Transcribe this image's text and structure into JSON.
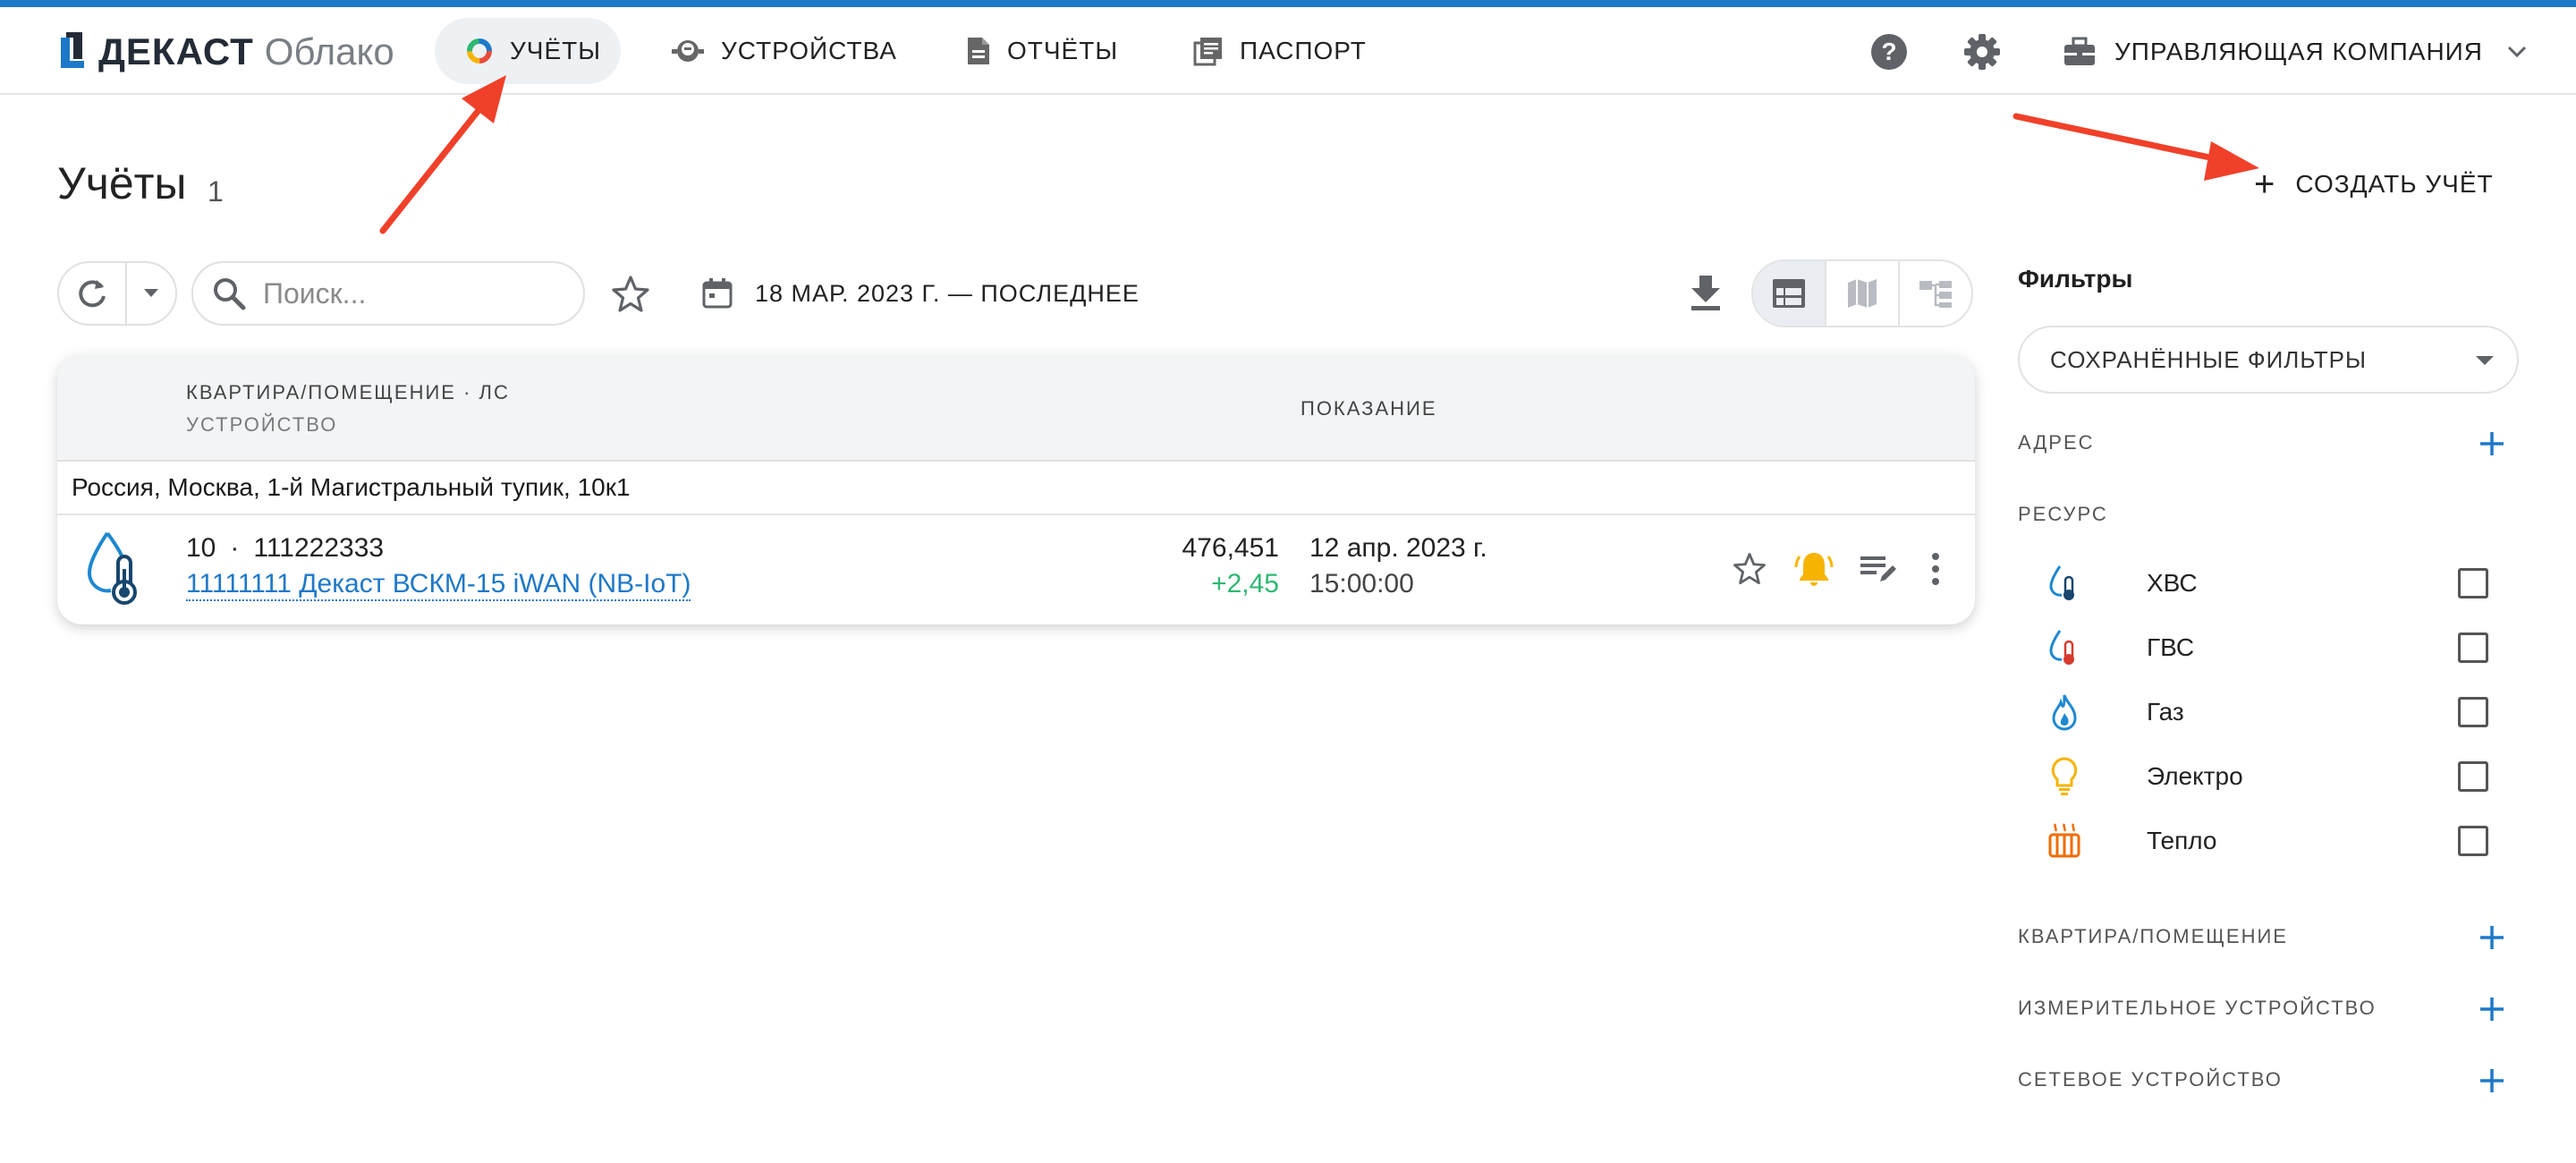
{
  "brand": {
    "name": "ДЕКАСТ",
    "product": "Облако"
  },
  "nav": [
    {
      "label": "УЧЁТЫ",
      "icon": "donut-chart-icon",
      "active": true
    },
    {
      "label": "УСТРОЙСТВА",
      "icon": "meter-device-icon",
      "active": false
    },
    {
      "label": "ОТЧЁТЫ",
      "icon": "document-icon",
      "active": false
    },
    {
      "label": "ПАСПОРТ",
      "icon": "passport-book-icon",
      "active": false
    }
  ],
  "header": {
    "help_icon": "help-circle-icon",
    "settings_icon": "gear-icon",
    "company": "УПРАВЛЯЮЩАЯ КОМПАНИЯ"
  },
  "page": {
    "title": "Учёты",
    "count": "1",
    "create_label": "СОЗДАТЬ УЧЁТ"
  },
  "toolbar": {
    "search_placeholder": "Поиск...",
    "date_range": "18 МАР. 2023 Г. — ПОСЛЕДНЕЕ",
    "views": [
      "table-view-icon",
      "map-view-icon",
      "tree-view-icon"
    ],
    "active_view": "table-view-icon"
  },
  "table": {
    "col_apartment": "КВАРТИРА/ПОМЕЩЕНИЕ · ЛС",
    "col_device": "УСТРОЙСТВО",
    "col_reading": "ПОКАЗАНИЕ",
    "group": "Россия, Москва, 1-й Магистральный тупик, 10к1",
    "rows": [
      {
        "apartment": "10",
        "account": "111222333",
        "device": "11111111 Декаст ВСКМ-15 iWAN (NB-IoT)",
        "value": "476,451",
        "delta": "+2,45",
        "date": "12 апр. 2023 г.",
        "time": "15:00:00",
        "resource_icon": "cold-water-icon"
      }
    ]
  },
  "filters": {
    "title": "Фильтры",
    "saved": "СОХРАНЁННЫЕ ФИЛЬТРЫ",
    "address": "АДРЕС",
    "resource": "РЕСУРС",
    "resources": [
      {
        "label": "ХВС",
        "icon": "cold-water-icon",
        "checked": false
      },
      {
        "label": "ГВС",
        "icon": "hot-water-icon",
        "checked": false
      },
      {
        "label": "Газ",
        "icon": "gas-flame-icon",
        "checked": false
      },
      {
        "label": "Электро",
        "icon": "lightbulb-icon",
        "checked": false
      },
      {
        "label": "Тепло",
        "icon": "radiator-icon",
        "checked": false
      }
    ],
    "apartment": "КВАРТИРА/ПОМЕЩЕНИЕ",
    "meter": "ИЗМЕРИТЕЛЬНОЕ УСТРОЙСТВО",
    "network": "СЕТЕВОЕ УСТРОЙСТВО"
  },
  "colors": {
    "accent": "#1e78c8",
    "positive": "#2eb872",
    "alert": "#f6b400",
    "annotation": "#f0402a"
  }
}
